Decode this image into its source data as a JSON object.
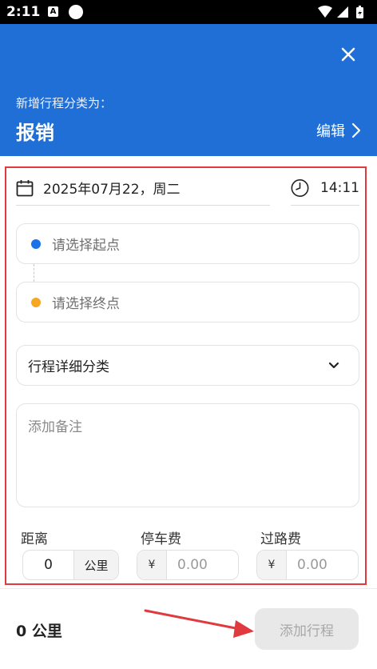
{
  "status_bar": {
    "time": "2:11",
    "notification_letter": "A"
  },
  "header": {
    "subtitle": "新增行程分类为：",
    "title": "报销",
    "edit_label": "编辑",
    "background_color": "#1f6fd6"
  },
  "form": {
    "date": "2025年07月22，周二",
    "time": "14:11",
    "start_placeholder": "请选择起点",
    "start_dot_color": "#1a73e8",
    "end_placeholder": "请选择终点",
    "end_dot_color": "#f5a623",
    "category_label": "行程详细分类",
    "remark_placeholder": "添加备注",
    "distance_label": "距离",
    "distance_value": "0",
    "distance_unit": "公里",
    "parking_label": "停车费",
    "parking_currency": "¥",
    "parking_placeholder": "0.00",
    "toll_label": "过路费",
    "toll_currency": "¥",
    "toll_placeholder": "0.00"
  },
  "footer": {
    "total_distance": "0 公里",
    "add_button_label": "添加行程"
  },
  "annotation_color": "#e0393e"
}
